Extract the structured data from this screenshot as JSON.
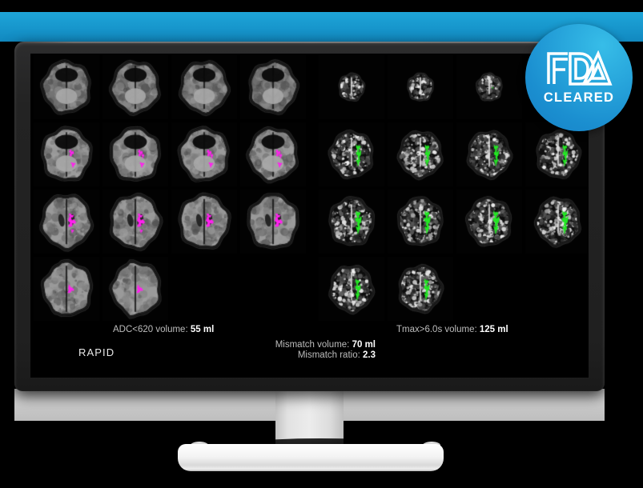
{
  "app": {
    "product_name": "RAPID",
    "banner_color": "#189fd4",
    "bezel_color": "#232323",
    "screen_bg": "#000000"
  },
  "badge": {
    "mark_text": "FDA",
    "label": "CLEARED",
    "circle_color": "#1b8fd0",
    "text_color": "#ffffff"
  },
  "study": {
    "left_panel": {
      "name": "diffusion-panel",
      "overlay_color": "#ff22ee",
      "overlay_label": "ADC<620 core",
      "rows": [
        4,
        4,
        4,
        2
      ]
    },
    "right_panel": {
      "name": "perfusion-panel",
      "overlay_color": "#22e622",
      "overlay_label": "Tmax>6.0s penumbra",
      "rows": [
        3,
        4,
        4,
        2
      ]
    }
  },
  "readouts": {
    "adc_label": "ADC<620 volume:",
    "adc_value": "55 ml",
    "tmax_label": "Tmax>6.0s volume:",
    "tmax_value": "125 ml",
    "mismatch_volume_label": "Mismatch volume:",
    "mismatch_volume_value": "70 ml",
    "mismatch_ratio_label": "Mismatch ratio:",
    "mismatch_ratio_value": "2.3"
  }
}
